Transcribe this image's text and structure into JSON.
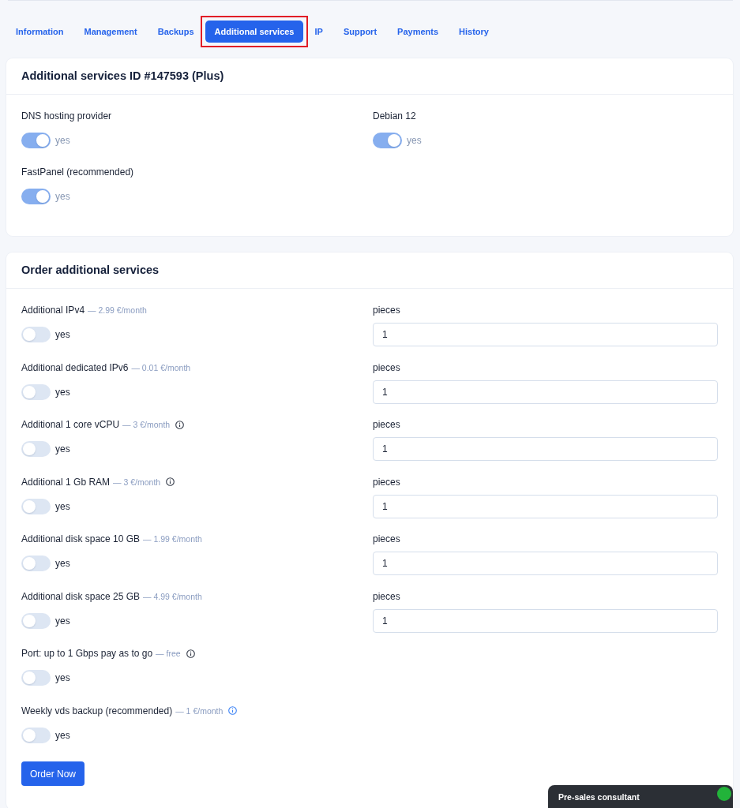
{
  "tabs": [
    {
      "label": "Information",
      "selected": false,
      "outlined": false
    },
    {
      "label": "Management",
      "selected": false,
      "outlined": false
    },
    {
      "label": "Backups",
      "selected": false,
      "outlined": false
    },
    {
      "label": "Additional services",
      "selected": true,
      "outlined": true
    },
    {
      "label": "IP",
      "selected": false,
      "outlined": false
    },
    {
      "label": "Support",
      "selected": false,
      "outlined": false
    },
    {
      "label": "Payments",
      "selected": false,
      "outlined": false
    },
    {
      "label": "History",
      "selected": false,
      "outlined": false
    }
  ],
  "current_services": {
    "title": "Additional services ID #147593 (Plus)",
    "items": [
      {
        "label": "DNS hosting provider",
        "toggle_label": "yes",
        "on": true,
        "disabled": true
      },
      {
        "label": "Debian 12",
        "toggle_label": "yes",
        "on": true,
        "disabled": true
      },
      {
        "label": "FastPanel (recommended)",
        "toggle_label": "yes",
        "on": true,
        "disabled": true
      }
    ]
  },
  "order": {
    "title": "Order additional services",
    "items": [
      {
        "label": "Additional IPv4",
        "price": "— 2.99 €/month",
        "info_icon": false,
        "toggle_label": "yes",
        "on": false,
        "disabled": false,
        "quantity": {
          "label": "pieces",
          "value": "1"
        }
      },
      {
        "label": "Additional dedicated IPv6",
        "price": "— 0.01 €/month",
        "info_icon": false,
        "toggle_label": "yes",
        "on": false,
        "disabled": false,
        "quantity": {
          "label": "pieces",
          "value": "1"
        }
      },
      {
        "label": "Additional 1 core vCPU",
        "price": "— 3 €/month",
        "info_icon": true,
        "info_highlighted": false,
        "toggle_label": "yes",
        "on": false,
        "disabled": false,
        "quantity": {
          "label": "pieces",
          "value": "1"
        }
      },
      {
        "label": "Additional 1 Gb RAM",
        "price": "— 3 €/month",
        "info_icon": true,
        "info_highlighted": false,
        "toggle_label": "yes",
        "on": false,
        "disabled": false,
        "quantity": {
          "label": "pieces",
          "value": "1"
        }
      },
      {
        "label": "Additional disk space 10 GB",
        "price": "— 1.99 €/month",
        "info_icon": false,
        "toggle_label": "yes",
        "on": false,
        "disabled": false,
        "quantity": {
          "label": "pieces",
          "value": "1"
        }
      },
      {
        "label": "Additional disk space 25 GB",
        "price": "— 4.99 €/month",
        "info_icon": false,
        "toggle_label": "yes",
        "on": false,
        "disabled": false,
        "quantity": {
          "label": "pieces",
          "value": "1"
        }
      },
      {
        "label": "Port: up to 1 Gbps pay as to go",
        "price": "— free",
        "info_icon": true,
        "info_highlighted": false,
        "toggle_label": "yes",
        "on": false,
        "disabled": false
      },
      {
        "label": "Weekly vds backup (recommended)",
        "price": "— 1 €/month",
        "info_icon": true,
        "info_highlighted": true,
        "toggle_label": "yes",
        "on": false,
        "disabled": false
      }
    ],
    "submit": "Order Now"
  },
  "chat_widget": {
    "title": "Pre-sales consultant",
    "online": true
  }
}
